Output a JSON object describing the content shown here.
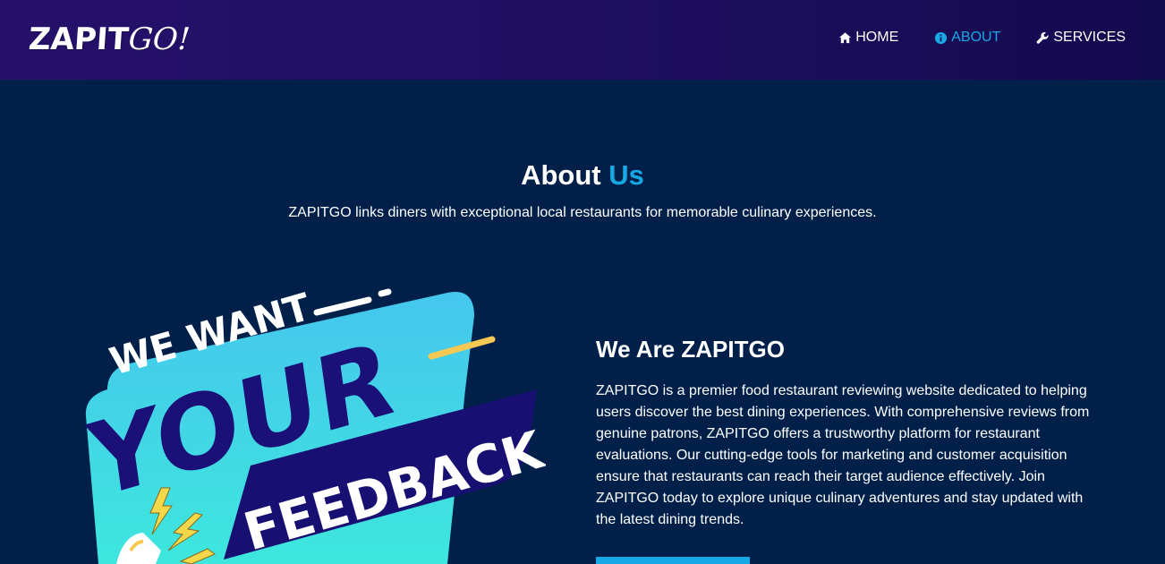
{
  "header": {
    "logo_main": "ZAPIT",
    "logo_go": "GO!",
    "nav": [
      {
        "label": "HOME",
        "icon": "home-icon"
      },
      {
        "label": "ABOUT",
        "icon": "info-icon",
        "active": true
      },
      {
        "label": "SERVICES",
        "icon": "wrench-icon"
      }
    ]
  },
  "about": {
    "title_main": "About",
    "title_accent": "Us",
    "subtitle": "ZAPITGO links diners with exceptional local restaurants for memorable culinary experiences."
  },
  "banner": {
    "line1": "WE WANT",
    "line2": "YOUR",
    "line3": "FEEDBACK"
  },
  "intro": {
    "heading": "We Are ZAPITGO",
    "paragraph": "ZAPITGO is a premier food restaurant reviewing website dedicated to helping users discover the best dining experiences. With comprehensive reviews from genuine patrons, ZAPITGO offers a trustworthy platform for restaurant evaluations. Our cutting-edge tools for marketing and customer acquisition ensure that restaurants can reach their target audience effectively. Join ZAPITGO today to explore unique culinary adventures and stay updated with the latest dining trends."
  },
  "colors": {
    "accent": "#17a9e6",
    "background": "#00204a",
    "navbar": "#1e0f60",
    "banner_cyan": "#3ee0e0",
    "banner_navy": "#170f72"
  }
}
